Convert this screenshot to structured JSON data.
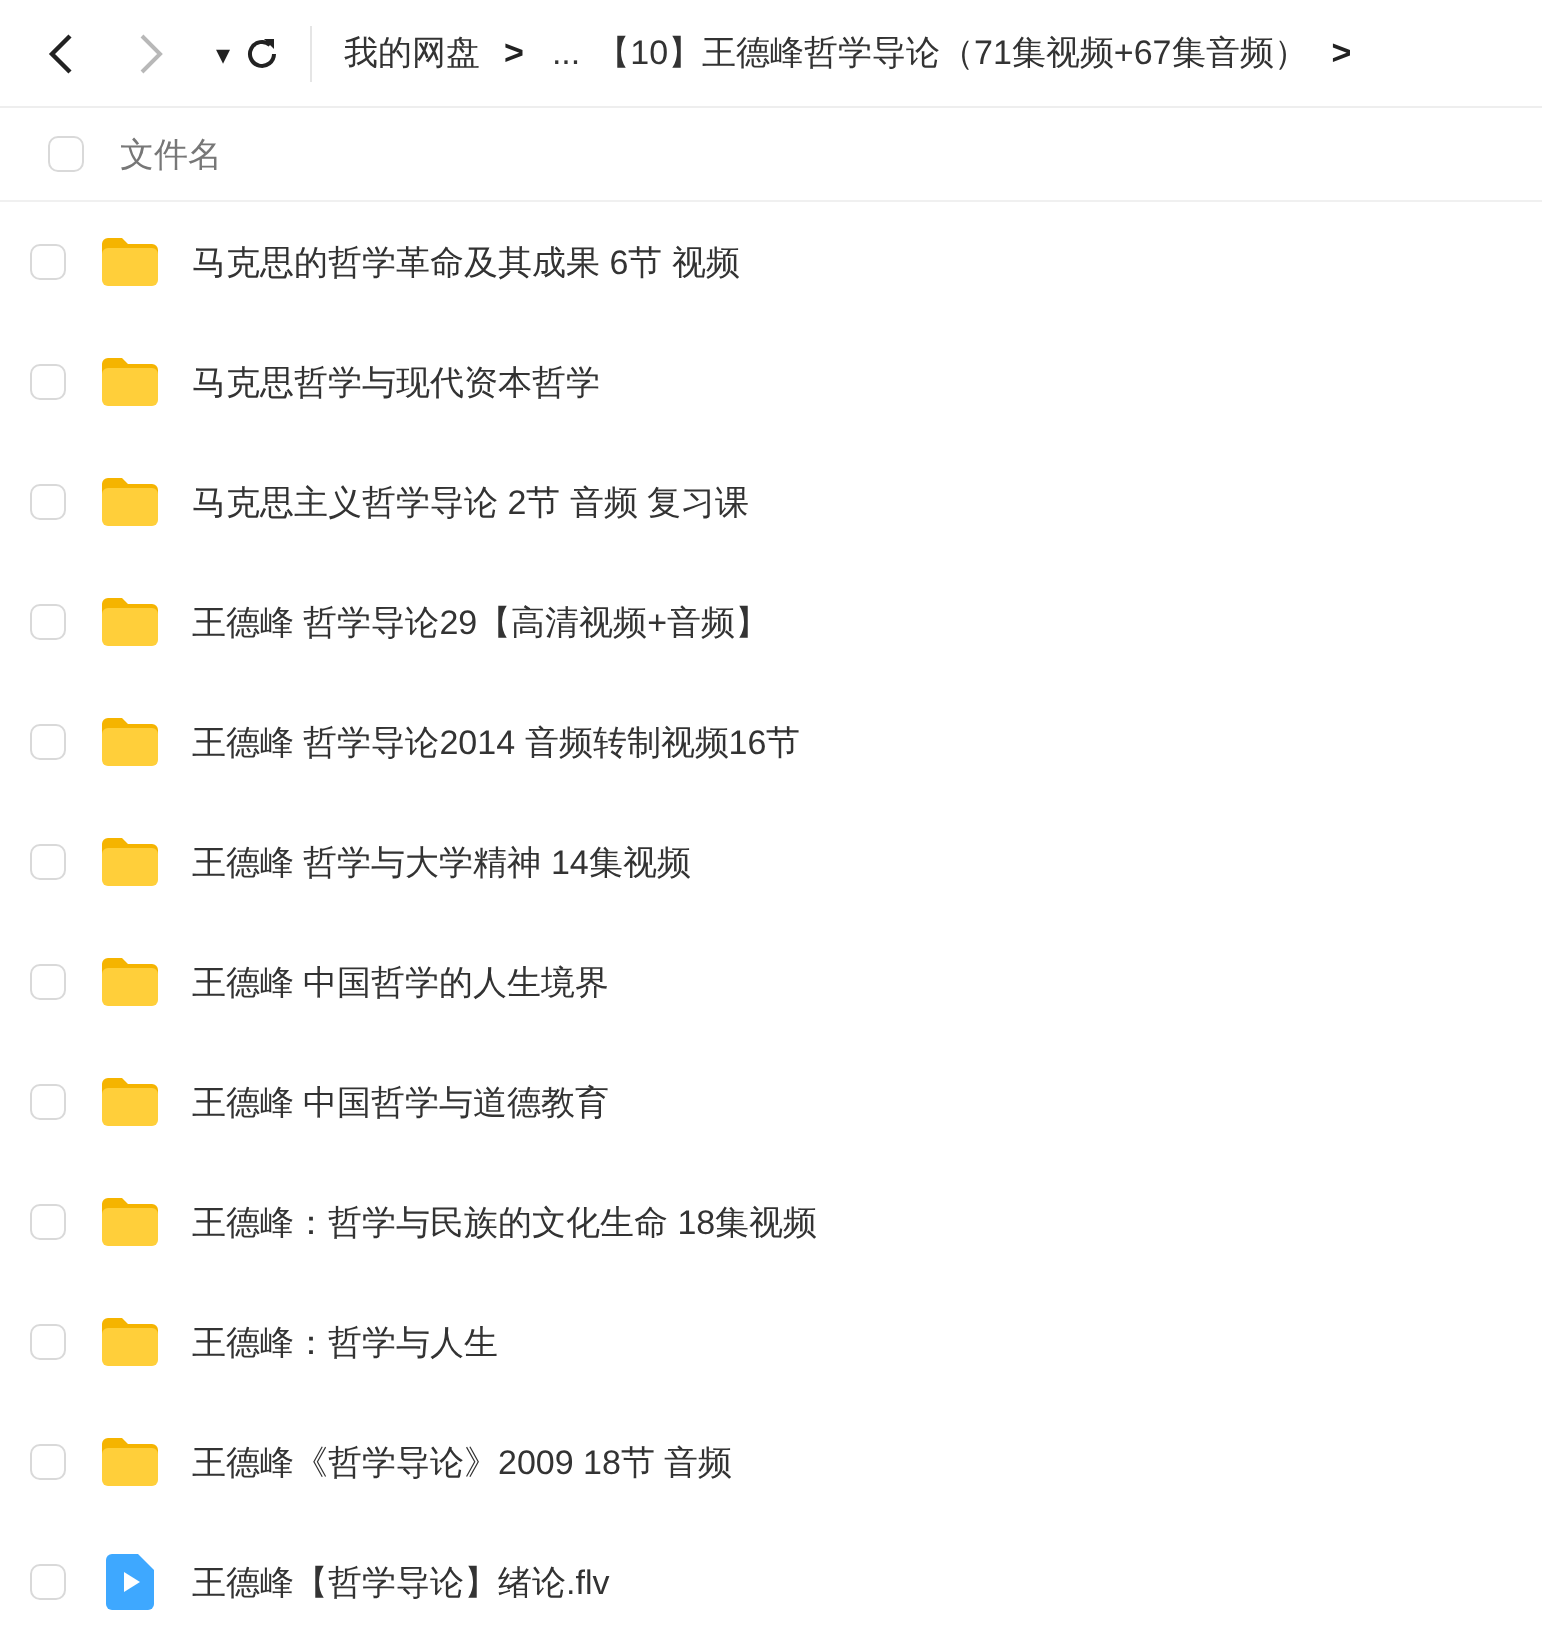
{
  "toolbar": {
    "back": {
      "disabled": false
    },
    "forward": {
      "disabled": true
    },
    "dropdown": "▾",
    "breadcrumb": [
      {
        "kind": "crumb",
        "text": "我的网盘"
      },
      {
        "kind": "sep",
        "text": ">"
      },
      {
        "kind": "crumb",
        "text": "..."
      },
      {
        "kind": "crumb",
        "text": "【10】王德峰哲学导论（71集视频+67集音频）"
      },
      {
        "kind": "sep",
        "text": ">"
      }
    ]
  },
  "header": {
    "checked": false,
    "label": "文件名"
  },
  "files": [
    {
      "kind": "folder",
      "name": "马克思的哲学革命及其成果 6节 视频",
      "checked": false
    },
    {
      "kind": "folder",
      "name": "马克思哲学与现代资本哲学",
      "checked": false
    },
    {
      "kind": "folder",
      "name": "马克思主义哲学导论 2节 音频 复习课",
      "checked": false
    },
    {
      "kind": "folder",
      "name": "王德峰 哲学导论29【高清视频+音频】",
      "checked": false
    },
    {
      "kind": "folder",
      "name": "王德峰 哲学导论2014 音频转制视频16节",
      "checked": false
    },
    {
      "kind": "folder",
      "name": "王德峰 哲学与大学精神 14集视频",
      "checked": false
    },
    {
      "kind": "folder",
      "name": "王德峰 中国哲学的人生境界",
      "checked": false
    },
    {
      "kind": "folder",
      "name": "王德峰 中国哲学与道德教育",
      "checked": false
    },
    {
      "kind": "folder",
      "name": "王德峰：哲学与民族的文化生命 18集视频",
      "checked": false
    },
    {
      "kind": "folder",
      "name": "王德峰：哲学与人生",
      "checked": false
    },
    {
      "kind": "folder",
      "name": "王德峰《哲学导论》2009 18节 音频",
      "checked": false
    },
    {
      "kind": "video",
      "name": "王德峰【哲学导论】绪论.flv",
      "checked": false
    }
  ]
}
